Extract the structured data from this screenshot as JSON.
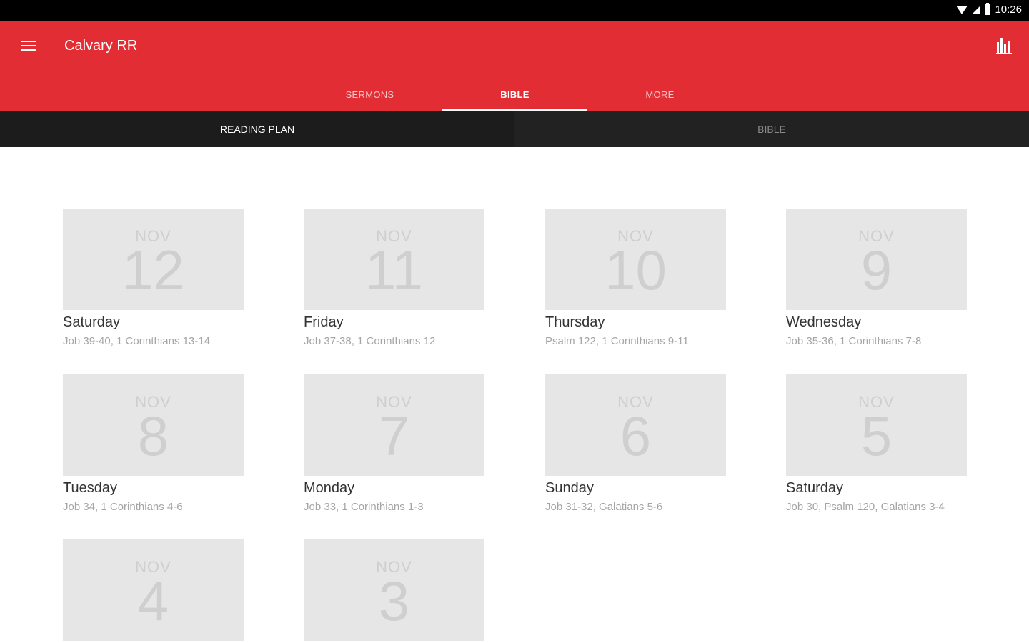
{
  "status_bar": {
    "time": "10:26"
  },
  "app_bar": {
    "title": "Calvary RR",
    "tabs": [
      {
        "label": "SERMONS"
      },
      {
        "label": "BIBLE"
      },
      {
        "label": "MORE"
      }
    ],
    "active_tab": "BIBLE",
    "accent_color": "#e32d34"
  },
  "subtabs": [
    {
      "label": "READING PLAN"
    },
    {
      "label": "BIBLE"
    }
  ],
  "readings": [
    {
      "month": "NOV",
      "day": "12",
      "weekday": "Saturday",
      "passages": "Job 39-40, 1 Corinthians 13-14"
    },
    {
      "month": "NOV",
      "day": "11",
      "weekday": "Friday",
      "passages": "Job 37-38, 1 Corinthians 12"
    },
    {
      "month": "NOV",
      "day": "10",
      "weekday": "Thursday",
      "passages": "Psalm 122, 1 Corinthians 9-11"
    },
    {
      "month": "NOV",
      "day": "9",
      "weekday": "Wednesday",
      "passages": "Job 35-36, 1 Corinthians 7-8"
    },
    {
      "month": "NOV",
      "day": "8",
      "weekday": "Tuesday",
      "passages": "Job 34, 1 Corinthians 4-6"
    },
    {
      "month": "NOV",
      "day": "7",
      "weekday": "Monday",
      "passages": "Job 33, 1 Corinthians 1-3"
    },
    {
      "month": "NOV",
      "day": "6",
      "weekday": "Sunday",
      "passages": "Job 31-32, Galatians 5-6"
    },
    {
      "month": "NOV",
      "day": "5",
      "weekday": "Saturday",
      "passages": "Job 30, Psalm 120, Galatians 3-4"
    },
    {
      "month": "NOV",
      "day": "4",
      "weekday": "",
      "passages": ""
    },
    {
      "month": "NOV",
      "day": "3",
      "weekday": "",
      "passages": ""
    }
  ]
}
